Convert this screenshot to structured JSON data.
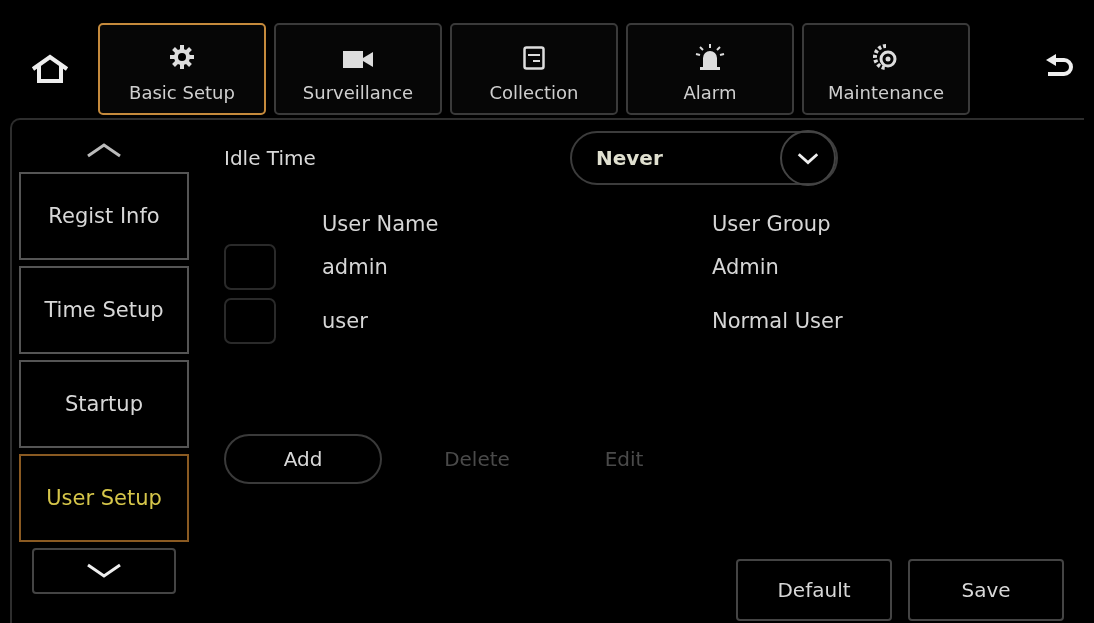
{
  "tabs": [
    {
      "label": "Basic Setup",
      "selected": true
    },
    {
      "label": "Surveillance",
      "selected": false
    },
    {
      "label": "Collection",
      "selected": false
    },
    {
      "label": "Alarm",
      "selected": false
    },
    {
      "label": "Maintenance",
      "selected": false
    }
  ],
  "sidebar": {
    "items": [
      {
        "label": "Regist Info",
        "selected": false
      },
      {
        "label": "Time Setup",
        "selected": false
      },
      {
        "label": "Startup",
        "selected": false
      },
      {
        "label": "User Setup",
        "selected": true
      }
    ]
  },
  "idle_time": {
    "label": "Idle Time",
    "value": "Never"
  },
  "table": {
    "columns": [
      "User Name",
      "User Group"
    ],
    "rows": [
      {
        "checked": false,
        "cells": [
          "admin",
          "Admin"
        ]
      },
      {
        "checked": false,
        "cells": [
          "user",
          "Normal User"
        ]
      }
    ]
  },
  "actions": [
    {
      "label": "Add",
      "disabled": false
    },
    {
      "label": "Delete",
      "disabled": true
    },
    {
      "label": "Edit",
      "disabled": true
    }
  ],
  "footer_buttons": [
    "Default",
    "Save"
  ]
}
